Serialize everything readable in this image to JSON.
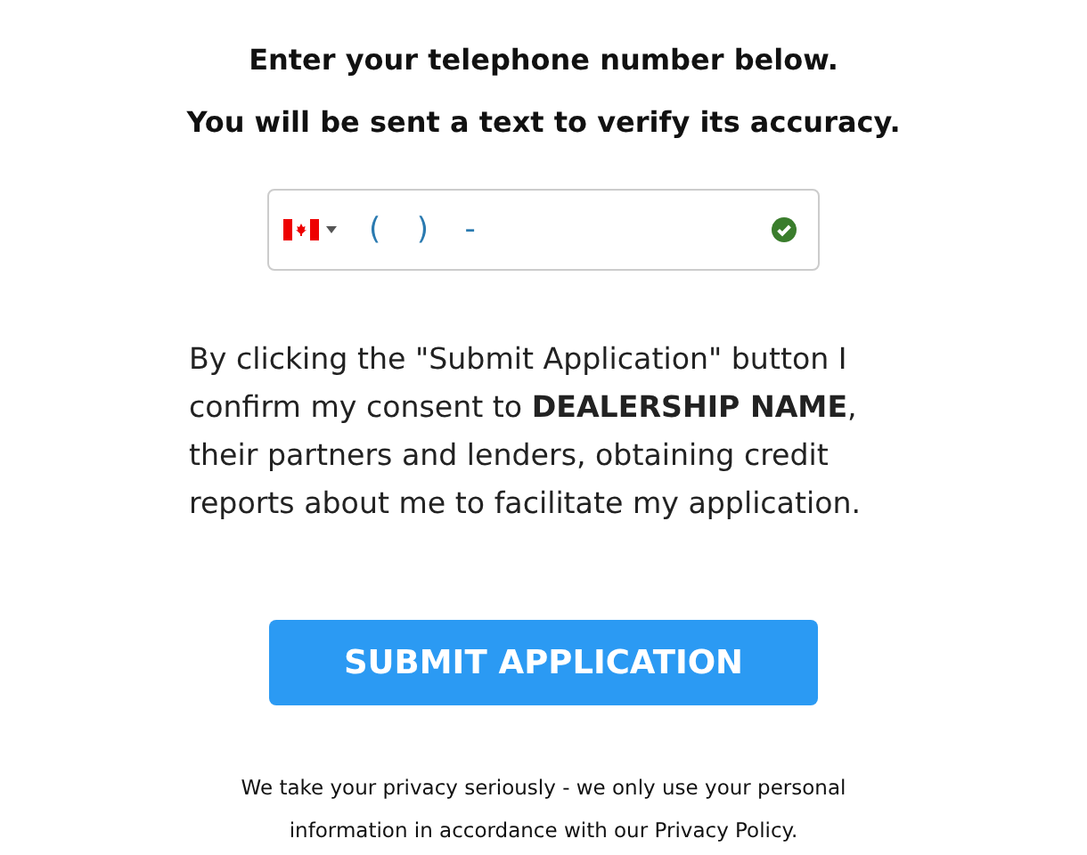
{
  "headings": [
    "Enter your telephone number below.",
    "You will be sent a text to verify its accuracy."
  ],
  "phone_field": {
    "value": "(   )   -",
    "valid": true
  },
  "consent": "By clicking the \"Submit Application\" button I confirm my consent to **DEALERSHIP NAME**, their partners and lenders, obtaining credit reports about me to facilitate my application.",
  "submit_button": "SUBMIT APPLICATION",
  "privacy_note": "We take your privacy seriously - we only use your personal information in accordance with our Privacy Policy."
}
